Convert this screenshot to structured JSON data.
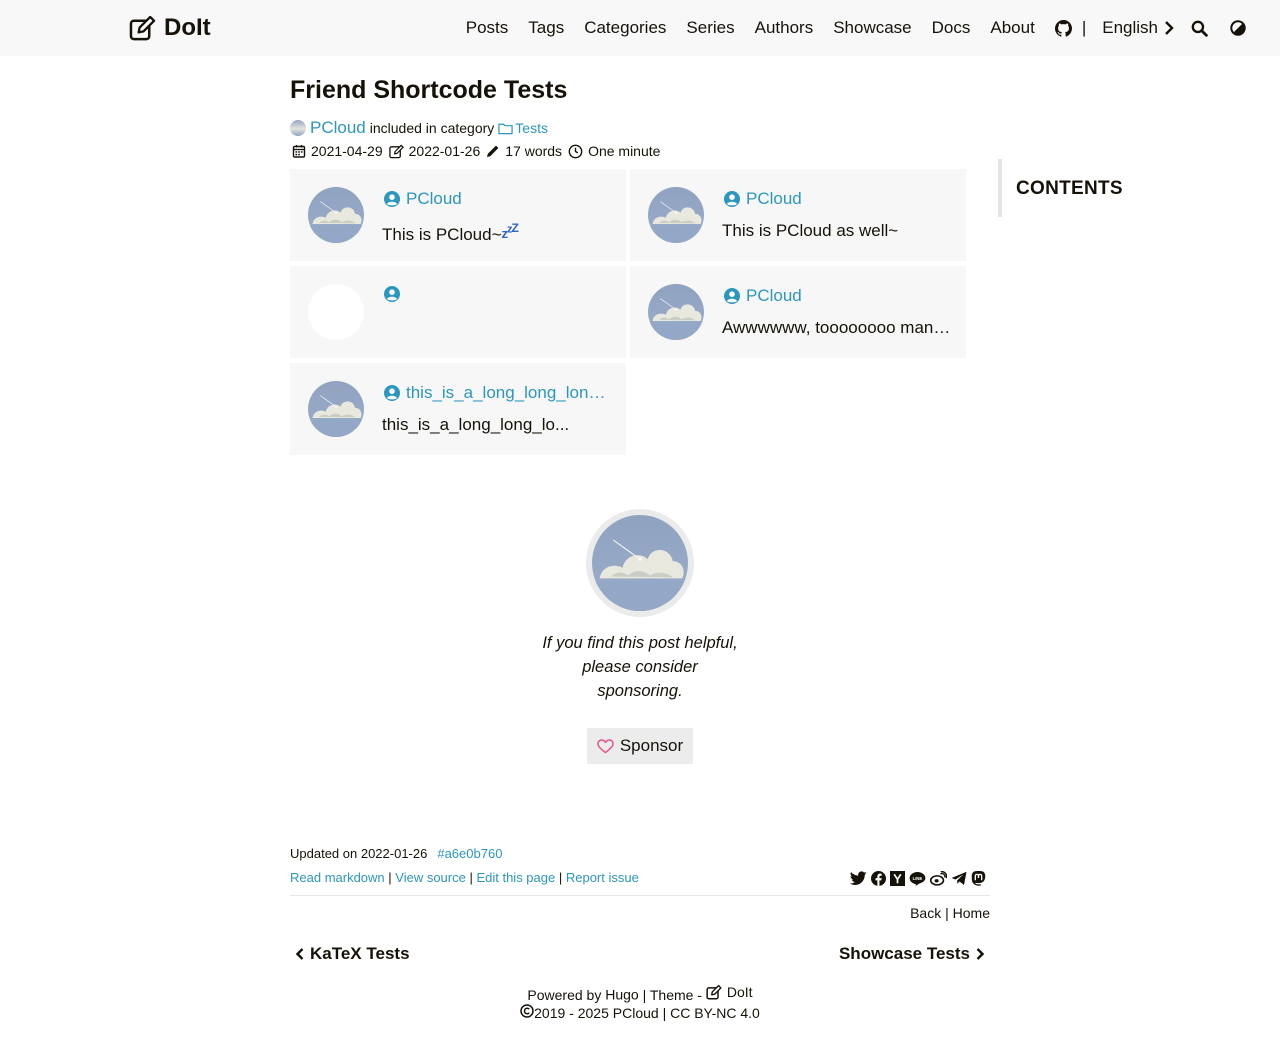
{
  "header": {
    "logo_text": "DoIt",
    "nav": [
      "Posts",
      "Tags",
      "Categories",
      "Series",
      "Authors",
      "Showcase",
      "Docs",
      "About"
    ],
    "separator": "|",
    "language": "English",
    "icons": [
      "github-icon",
      "search-icon",
      "theme-toggle-icon"
    ]
  },
  "post": {
    "title": "Friend Shortcode Tests",
    "author": "PCloud",
    "included_text": "included in category",
    "category": "Tests",
    "published": "2021-04-29",
    "modified": "2022-01-26",
    "words": "17 words",
    "reading_time": "One minute"
  },
  "friends": [
    {
      "name": "PCloud",
      "desc": "This is PCloud~",
      "emoji": "zzz",
      "has_avatar": true
    },
    {
      "name": "PCloud",
      "desc": "This is PCloud as well~",
      "has_avatar": true
    },
    {
      "name": "",
      "desc": "",
      "has_avatar": false
    },
    {
      "name": "PCloud",
      "desc": "Awwwwww, toooooooo many...",
      "has_avatar": true
    },
    {
      "name": "this_is_a_long_long_long...",
      "desc": "this_is_a_long_long_lo...",
      "has_avatar": true
    }
  ],
  "toc": {
    "title": "CONTENTS"
  },
  "sponsor": {
    "text": "If you find this post helpful, please consider sponsoring.",
    "button": "Sponsor"
  },
  "post_footer": {
    "updated": "Updated on 2022-01-26",
    "commit": "a6e0b760",
    "links": [
      "Read markdown",
      "View source",
      "Edit this page",
      "Report issue"
    ],
    "share_icons": [
      "twitter-icon",
      "facebook-icon",
      "hackernews-icon",
      "line-icon",
      "weibo-icon",
      "telegram-icon",
      "mastodon-icon"
    ],
    "back": "Back",
    "home": "Home",
    "prev": "KaTeX Tests",
    "next": "Showcase Tests"
  },
  "site_footer": {
    "powered_prefix": "Powered by",
    "hugo": "Hugo",
    "theme_prefix": "| Theme -",
    "theme": "DoIt",
    "copyright": "2019 - 2025",
    "owner": "PCloud",
    "license": "CC BY-NC 4.0"
  },
  "colors": {
    "link": "#2d96bd",
    "text": "#161209",
    "header_bg": "#f8f8f8",
    "card_bg": "#f7f7f7",
    "heart": "#e6548c"
  }
}
